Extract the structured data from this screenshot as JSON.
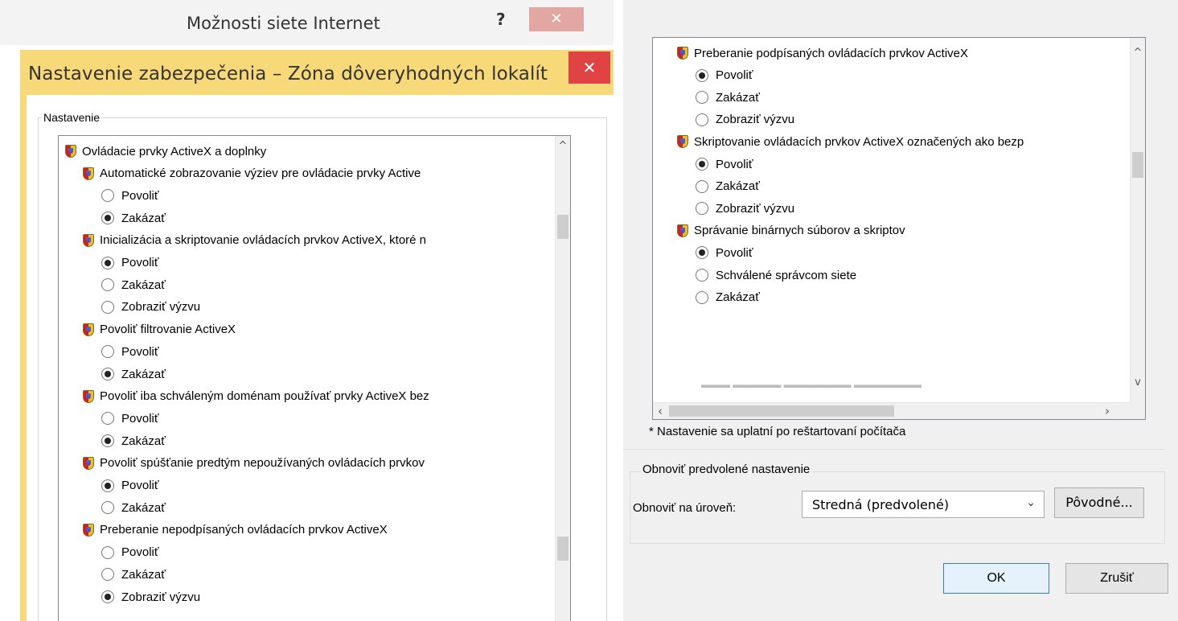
{
  "back_window": {
    "title": "Možnosti siete Internet",
    "help_label": "?",
    "close_label": "✕"
  },
  "dialog": {
    "title": "Nastavenie zabezpečenia – Zóna dôveryhodných lokalít",
    "close_label": "✕",
    "settings_legend": "Nastavenie",
    "tree_left": [
      {
        "type": "category",
        "label": "Ovládacie prvky ActiveX a doplnky"
      },
      {
        "type": "setting",
        "label": "Automatické zobrazovanie výziev pre ovládacie prvky Active"
      },
      {
        "type": "option",
        "label": "Povoliť",
        "selected": false
      },
      {
        "type": "option",
        "label": "Zakázať",
        "selected": true
      },
      {
        "type": "setting",
        "label": "Inicializácia a skriptovanie ovládacích prvkov ActiveX, ktoré n"
      },
      {
        "type": "option",
        "label": "Povoliť",
        "selected": true
      },
      {
        "type": "option",
        "label": "Zakázať",
        "selected": false
      },
      {
        "type": "option",
        "label": "Zobraziť výzvu",
        "selected": false
      },
      {
        "type": "setting",
        "label": "Povoliť filtrovanie ActiveX"
      },
      {
        "type": "option",
        "label": "Povoliť",
        "selected": false
      },
      {
        "type": "option",
        "label": "Zakázať",
        "selected": true
      },
      {
        "type": "setting",
        "label": "Povoliť iba schváleným doménam používať prvky ActiveX bez"
      },
      {
        "type": "option",
        "label": "Povoliť",
        "selected": false
      },
      {
        "type": "option",
        "label": "Zakázať",
        "selected": true
      },
      {
        "type": "setting",
        "label": "Povoliť spúšťanie predtým nepoužívaných ovládacích prvkov"
      },
      {
        "type": "option",
        "label": "Povoliť",
        "selected": true
      },
      {
        "type": "option",
        "label": "Zakázať",
        "selected": false
      },
      {
        "type": "setting",
        "label": "Preberanie nepodpísaných ovládacích prvkov ActiveX"
      },
      {
        "type": "option",
        "label": "Povoliť",
        "selected": false
      },
      {
        "type": "option",
        "label": "Zakázať",
        "selected": false
      },
      {
        "type": "option",
        "label": "Zobraziť výzvu",
        "selected": true
      }
    ],
    "tree_right": [
      {
        "type": "setting",
        "label": "Preberanie podpísaných ovládacích prvkov ActiveX"
      },
      {
        "type": "option",
        "label": "Povoliť",
        "selected": true
      },
      {
        "type": "option",
        "label": "Zakázať",
        "selected": false
      },
      {
        "type": "option",
        "label": "Zobraziť výzvu",
        "selected": false
      },
      {
        "type": "setting",
        "label": "Skriptovanie ovládacích prvkov ActiveX označených ako bezp"
      },
      {
        "type": "option",
        "label": "Povoliť",
        "selected": true
      },
      {
        "type": "option",
        "label": "Zakázať",
        "selected": false
      },
      {
        "type": "option",
        "label": "Zobraziť výzvu",
        "selected": false
      },
      {
        "type": "setting",
        "label": "Správanie binárnych súborov a skriptov"
      },
      {
        "type": "option",
        "label": "Povoliť",
        "selected": true
      },
      {
        "type": "option",
        "label": "Schválené správcom siete",
        "selected": false
      },
      {
        "type": "option",
        "label": "Zakázať",
        "selected": false
      }
    ],
    "note": "* Nastavenie sa uplatní po reštartovaní počítača",
    "reset": {
      "legend": "Obnoviť predvolené nastavenie",
      "level_label": "Obnoviť na úroveň:",
      "level_value": "Stredná (predvolené)",
      "default_button": "Pôvodné..."
    },
    "ok_label": "OK",
    "cancel_label": "Zrušiť"
  },
  "colors": {
    "active_title": "#f8d97a",
    "close_red": "#e04343"
  },
  "icons": {
    "setting_icon": "shield-icon",
    "option_icon": "radio-button"
  }
}
